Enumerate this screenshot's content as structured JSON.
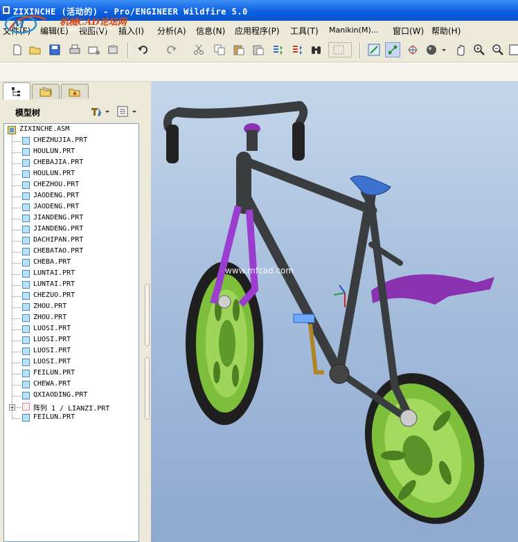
{
  "window": {
    "title": "ZIXINCHE (活动的) - Pro/ENGINEER Wildfire 5.0"
  },
  "watermark": {
    "logo_text": "机械CAD论坛网",
    "logo_url": "www.mfcad.com",
    "viewport_text": "www.mfcad.com"
  },
  "menu": {
    "items": [
      "文件(F)",
      "编辑(E)",
      "视图(V)",
      "插入(I)",
      "分析(A)",
      "信息(N)",
      "应用程序(P)",
      "工具(T)",
      "Manikin(M)...",
      "窗口(W)",
      "帮助(H)"
    ]
  },
  "toolbar": {
    "icons": [
      "new-icon",
      "open-icon",
      "save-icon",
      "print-icon",
      "email-icon",
      "copy-to-clipboard-icon",
      "undo-icon",
      "redo-icon",
      "cut-icon",
      "copy-icon",
      "paste-icon",
      "paste-special-icon",
      "regenerate-icon",
      "regenerate-manager-icon",
      "find-icon",
      "select-box-icon",
      "repaint-icon",
      "orient-icon",
      "spin-center-icon",
      "shading-icon",
      "pan-icon",
      "zoom-in-icon",
      "zoom-out-icon",
      "refit-icon"
    ]
  },
  "model_tree": {
    "label": "模型树",
    "root": "ZIXINCHE.ASM",
    "items": [
      {
        "name": "CHEZHUJIA.PRT",
        "type": "part"
      },
      {
        "name": "HOULUN.PRT",
        "type": "part"
      },
      {
        "name": "CHEBAJIA.PRT",
        "type": "part"
      },
      {
        "name": "HOULUN.PRT",
        "type": "part"
      },
      {
        "name": "CHEZHOU.PRT",
        "type": "part"
      },
      {
        "name": "JAODENG.PRT",
        "type": "part"
      },
      {
        "name": "JAODENG.PRT",
        "type": "part"
      },
      {
        "name": "JIANDENG.PRT",
        "type": "part"
      },
      {
        "name": "JIANDENG.PRT",
        "type": "part"
      },
      {
        "name": "DACHIPAN.PRT",
        "type": "part"
      },
      {
        "name": "CHEBATAO.PRT",
        "type": "part"
      },
      {
        "name": "CHEBA.PRT",
        "type": "part"
      },
      {
        "name": "LUNTAI.PRT",
        "type": "part"
      },
      {
        "name": "LUNTAI.PRT",
        "type": "part"
      },
      {
        "name": "CHEZUO.PRT",
        "type": "part"
      },
      {
        "name": "ZHOU.PRT",
        "type": "part"
      },
      {
        "name": "ZHOU.PRT",
        "type": "part"
      },
      {
        "name": "LUOSI.PRT",
        "type": "part"
      },
      {
        "name": "LUOSI.PRT",
        "type": "part"
      },
      {
        "name": "LUOSI.PRT",
        "type": "part"
      },
      {
        "name": "LUOSI.PRT",
        "type": "part"
      },
      {
        "name": "FEILUN.PRT",
        "type": "part"
      },
      {
        "name": "CHEWA.PRT",
        "type": "part"
      },
      {
        "name": "QXIAODING.PRT",
        "type": "part"
      },
      {
        "name": "阵列 1 / LIANZI.PRT",
        "type": "pattern"
      },
      {
        "name": "FEILUN.PRT",
        "type": "part"
      }
    ]
  }
}
